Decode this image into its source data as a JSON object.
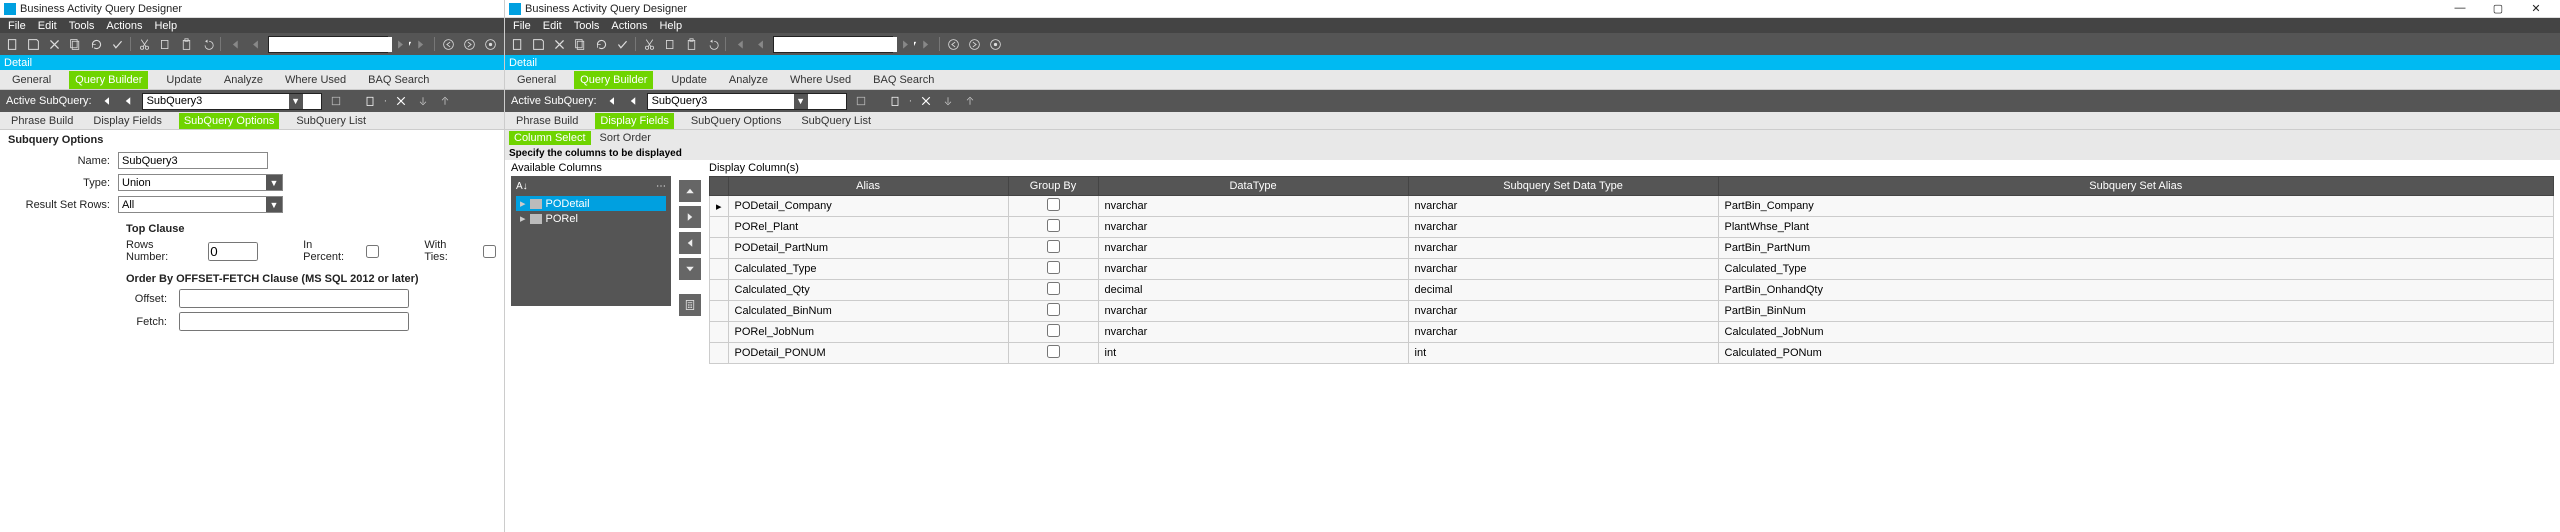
{
  "app": {
    "title": "Business Activity Query Designer"
  },
  "menu": {
    "items": [
      "File",
      "Edit",
      "Tools",
      "Actions",
      "Help"
    ]
  },
  "detail_label": "Detail",
  "main_tabs": {
    "items": [
      "General",
      "Query Builder",
      "Update",
      "Analyze",
      "Where Used",
      "BAQ Search"
    ],
    "active": 1
  },
  "subquery_bar": {
    "label": "Active SubQuery:",
    "value": "SubQuery3"
  },
  "left": {
    "tabs2": {
      "items": [
        "Phrase Build",
        "Display Fields",
        "SubQuery Options",
        "SubQuery List"
      ],
      "active": 2
    },
    "section_title": "Subquery Options",
    "name_label": "Name:",
    "name_value": "SubQuery3",
    "type_label": "Type:",
    "type_value": "Union",
    "rsr_label": "Result Set Rows:",
    "rsr_value": "All",
    "top_clause_hdr": "Top Clause",
    "rows_label": "Rows Number:",
    "rows_value": "0",
    "in_percent_label": "In Percent:",
    "with_ties_label": "With Ties:",
    "orderby_hdr": "Order By OFFSET-FETCH Clause    (MS SQL 2012 or later)",
    "offset_label": "Offset:",
    "offset_value": "",
    "fetch_label": "Fetch:",
    "fetch_value": ""
  },
  "right": {
    "tabs2": {
      "items": [
        "Phrase Build",
        "Display Fields",
        "SubQuery Options",
        "SubQuery List"
      ],
      "active": 1
    },
    "tabs3": {
      "items": [
        "Column Select",
        "Sort Order"
      ],
      "active": 0
    },
    "specify": "Specify the columns to be displayed",
    "avail_label": "Available Columns",
    "display_label": "Display Column(s)",
    "tree_items": [
      {
        "label": "PODetail",
        "selected": true
      },
      {
        "label": "PORel",
        "selected": false
      }
    ],
    "grid": {
      "headers": [
        "Alias",
        "Group By",
        "DataType",
        "Subquery Set Data Type",
        "Subquery Set Alias"
      ],
      "rows": [
        {
          "alias": "PODetail_Company",
          "groupby": false,
          "datatype": "nvarchar",
          "sdt": "nvarchar",
          "sa": "PartBin_Company",
          "current": true
        },
        {
          "alias": "PORel_Plant",
          "groupby": false,
          "datatype": "nvarchar",
          "sdt": "nvarchar",
          "sa": "PlantWhse_Plant"
        },
        {
          "alias": "PODetail_PartNum",
          "groupby": false,
          "datatype": "nvarchar",
          "sdt": "nvarchar",
          "sa": "PartBin_PartNum"
        },
        {
          "alias": "Calculated_Type",
          "groupby": false,
          "datatype": "nvarchar",
          "sdt": "nvarchar",
          "sa": "Calculated_Type"
        },
        {
          "alias": "Calculated_Qty",
          "groupby": false,
          "datatype": "decimal",
          "sdt": "decimal",
          "sa": "PartBin_OnhandQty"
        },
        {
          "alias": "Calculated_BinNum",
          "groupby": false,
          "datatype": "nvarchar",
          "sdt": "nvarchar",
          "sa": "PartBin_BinNum"
        },
        {
          "alias": "PORel_JobNum",
          "groupby": false,
          "datatype": "nvarchar",
          "sdt": "nvarchar",
          "sa": "Calculated_JobNum"
        },
        {
          "alias": "PODetail_PONUM",
          "groupby": false,
          "datatype": "int",
          "sdt": "int",
          "sa": "Calculated_PONum"
        }
      ]
    }
  },
  "win": {
    "min": "—",
    "max": "▢",
    "close": "✕"
  }
}
